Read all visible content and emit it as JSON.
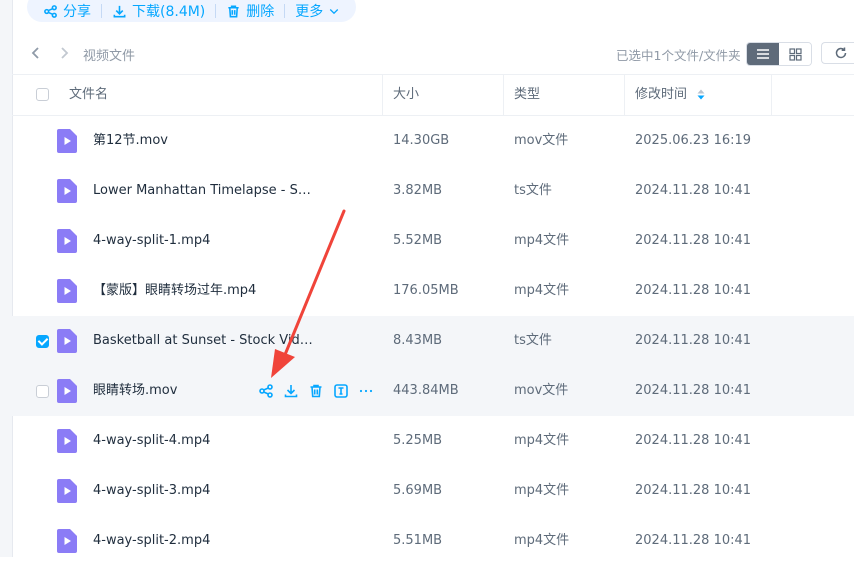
{
  "toolbar": {
    "share": "分享",
    "download": "下载(8.4M)",
    "delete": "删除",
    "more": "更多"
  },
  "nav": {
    "breadcrumb": "视频文件",
    "selection_info": "已选中1个文件/文件夹"
  },
  "table": {
    "headers": {
      "name": "文件名",
      "size": "大小",
      "type": "类型",
      "modified": "修改时间"
    },
    "rows": [
      {
        "name": "第12节.mov",
        "size": "14.30GB",
        "type": "mov文件",
        "modified": "2025.06.23 16:19",
        "checked": false
      },
      {
        "name": "Lower Manhattan Timelapse - Stoc...",
        "size": "3.82MB",
        "type": "ts文件",
        "modified": "2024.11.28 10:41",
        "checked": false
      },
      {
        "name": "4-way-split-1.mp4",
        "size": "5.52MB",
        "type": "mp4文件",
        "modified": "2024.11.28 10:41",
        "checked": false
      },
      {
        "name": "【蒙版】眼睛转场过年.mp4",
        "size": "176.05MB",
        "type": "mp4文件",
        "modified": "2024.11.28 10:41",
        "checked": false
      },
      {
        "name": "Basketball at Sunset - Stock Video...",
        "size": "8.43MB",
        "type": "ts文件",
        "modified": "2024.11.28 10:41",
        "checked": true
      },
      {
        "name": "眼睛转场.mov",
        "size": "443.84MB",
        "type": "mov文件",
        "modified": "2024.11.28 10:41",
        "checked": false
      },
      {
        "name": "4-way-split-4.mp4",
        "size": "5.25MB",
        "type": "mp4文件",
        "modified": "2024.11.28 10:41",
        "checked": false
      },
      {
        "name": "4-way-split-3.mp4",
        "size": "5.69MB",
        "type": "mp4文件",
        "modified": "2024.11.28 10:41",
        "checked": false
      },
      {
        "name": "4-way-split-2.mp4",
        "size": "5.51MB",
        "type": "mp4文件",
        "modified": "2024.11.28 10:41",
        "checked": false
      }
    ]
  },
  "colors": {
    "accent": "#06a7ff",
    "file_icon": "#8b7cf6",
    "annotation_arrow": "#f0443a"
  }
}
